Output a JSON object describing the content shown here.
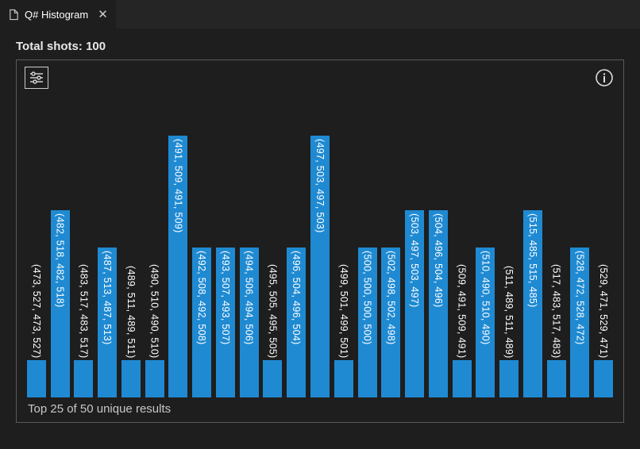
{
  "tab": {
    "title": "Q# Histogram",
    "file_icon": "file-icon",
    "close_icon": "close-icon"
  },
  "header": {
    "total_shots_label": "Total shots:",
    "total_shots_value": "100"
  },
  "panel": {
    "settings_icon": "settings-icon",
    "info_icon": "info-icon",
    "footer": "Top 25 of 50 unique results"
  },
  "colors": {
    "bar": "#1f8ad2",
    "bg": "#1e1e1e",
    "border": "#5a5a5a",
    "text": "#e8e8e8"
  },
  "chart_data": {
    "type": "bar",
    "title": "Q# Histogram",
    "xlabel": "",
    "ylabel": "",
    "ylim": [
      0,
      7
    ],
    "categories": [
      "(473, 527, 473, 527)",
      "(482, 518, 482, 518)",
      "(483, 517, 483, 517)",
      "(487, 513, 487, 513)",
      "(489, 511, 489, 511)",
      "(490, 510, 490, 510)",
      "(491, 509, 491, 509)",
      "(492, 508, 492, 508)",
      "(493, 507, 493, 507)",
      "(494, 506, 494, 506)",
      "(495, 505, 495, 505)",
      "(496, 504, 496, 504)",
      "(497, 503, 497, 503)",
      "(499, 501, 499, 501)",
      "(500, 500, 500, 500)",
      "(502, 498, 502, 498)",
      "(503, 497, 503, 497)",
      "(504, 496, 504, 496)",
      "(509, 491, 509, 491)",
      "(510, 490, 510, 490)",
      "(511, 489, 511, 489)",
      "(515, 485, 515, 485)",
      "(517, 483, 517, 483)",
      "(528, 472, 528, 472)",
      "(529, 471, 529, 471)"
    ],
    "values": [
      1,
      5,
      1,
      4,
      1,
      1,
      7,
      4,
      4,
      4,
      1,
      4,
      7,
      1,
      4,
      4,
      5,
      5,
      1,
      4,
      1,
      5,
      1,
      4,
      1
    ]
  }
}
